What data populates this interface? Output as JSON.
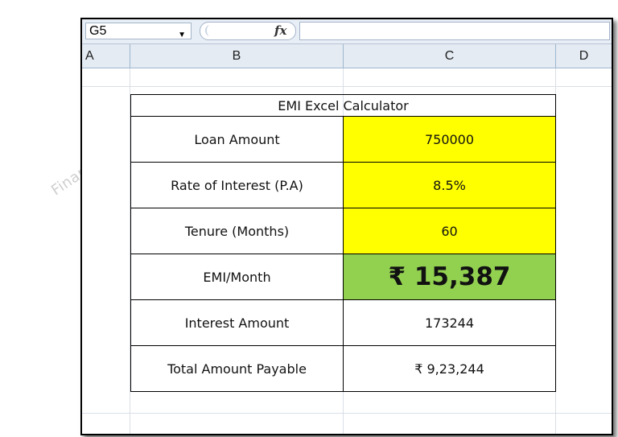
{
  "formula_bar": {
    "name_box": "G5",
    "fx_symbol": "fx",
    "formula": ""
  },
  "columns": [
    "A",
    "B",
    "C",
    "D"
  ],
  "watermark": "Financehelps.in",
  "table": {
    "title": "EMI Excel Calculator",
    "rows": [
      {
        "label": "Loan Amount",
        "value": "750000",
        "fill": "yellow"
      },
      {
        "label": "Rate of Interest (P.A)",
        "value": "8.5%",
        "fill": "yellow"
      },
      {
        "label": "Tenure (Months)",
        "value": "60",
        "fill": "yellow"
      },
      {
        "label": "EMI/Month",
        "value": "₹ 15,387",
        "fill": "green"
      },
      {
        "label": "Interest Amount",
        "value": "173244",
        "fill": "none"
      },
      {
        "label": "Total Amount Payable",
        "value": "₹ 9,23,244",
        "fill": "none"
      }
    ]
  },
  "colors": {
    "input_fill": "#ffff00",
    "result_fill": "#92d050",
    "header_bg": "#e4ebf3"
  }
}
